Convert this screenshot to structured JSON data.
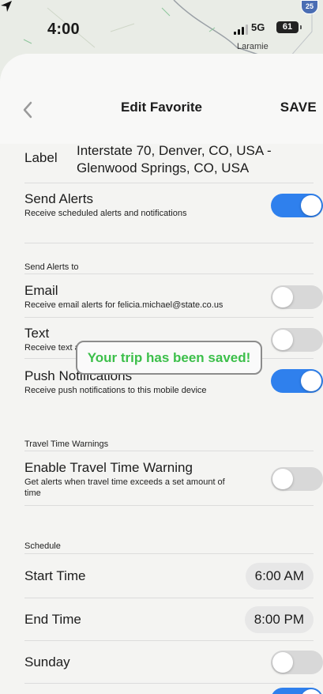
{
  "status_bar": {
    "time": "4:00",
    "network": "5G",
    "battery": "61",
    "map_city": "Laramie",
    "highway_shield": "25"
  },
  "header": {
    "title": "Edit Favorite",
    "save_label": "SAVE",
    "back_icon": "chevron-left-icon"
  },
  "label_row": {
    "key": "Label",
    "value": "Interstate 70, Denver, CO, USA - Glenwood Springs, CO, USA"
  },
  "send_alerts": {
    "title": "Send Alerts",
    "subtitle": "Receive scheduled alerts and notifications",
    "enabled": true
  },
  "send_alerts_to": {
    "section_label": "Send Alerts to",
    "items": [
      {
        "title": "Email",
        "subtitle": "Receive email alerts for felicia.michael@state.co.us",
        "enabled": false
      },
      {
        "title": "Text",
        "subtitle": "Receive text alerts for 3038861531",
        "enabled": false
      },
      {
        "title": "Push Notifications",
        "subtitle": "Receive push notifications to this mobile device",
        "enabled": true
      }
    ]
  },
  "toast": {
    "message": "Your trip has been saved!",
    "color": "#3cbf4a"
  },
  "travel_time": {
    "section_label": "Travel Time Warnings",
    "title": "Enable Travel Time Warning",
    "subtitle": "Get alerts when travel time exceeds a set amount of time",
    "enabled": false
  },
  "schedule": {
    "section_label": "Schedule",
    "start_label": "Start Time",
    "start_value": "6:00 AM",
    "end_label": "End Time",
    "end_value": "8:00 PM",
    "days": [
      {
        "label": "Sunday",
        "enabled": false
      }
    ]
  },
  "colors": {
    "accent": "#2f80ed",
    "toggle_off": "#d8d8d8",
    "background": "#f4f4f2"
  }
}
